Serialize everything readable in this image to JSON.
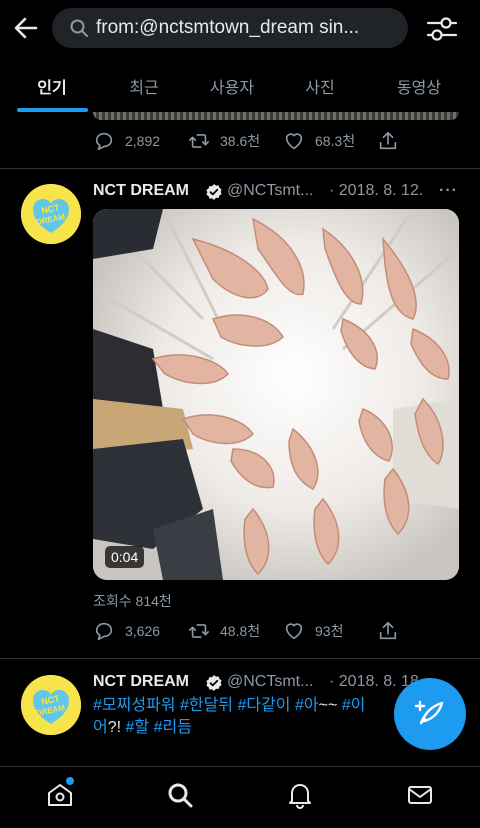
{
  "search": {
    "query": "from:@nctsmtown_dream sin..."
  },
  "tabs": [
    {
      "label": "인기",
      "active": true
    },
    {
      "label": "최근",
      "active": false
    },
    {
      "label": "사용자",
      "active": false
    },
    {
      "label": "사진",
      "active": false
    },
    {
      "label": "동영상",
      "active": false
    }
  ],
  "prev_tweet": {
    "replies": "2,892",
    "retweets": "38.6천",
    "likes": "68.3천"
  },
  "tweet1": {
    "name": "NCT DREAM",
    "handle": "@NCTsmt...",
    "date": "· 2018. 8. 12.",
    "more": "···",
    "video_duration": "0:04",
    "views": "조회수 814천",
    "replies": "3,626",
    "retweets": "48.8천",
    "likes": "93천"
  },
  "tweet2": {
    "name": "NCT DREAM",
    "handle": "@NCTsmt...",
    "date": "· 2018. 8. 18.",
    "text": {
      "h1": "#모찌성파워",
      "h2": "#한달뒤",
      "h3": "#다같이",
      "h4": "#아",
      "t1": "~~",
      "h5": "#이",
      "t2": "어",
      "t3": "?!",
      "h6": "#할",
      "h7": "#리듬"
    }
  },
  "colors": {
    "accent": "#1d9bf0",
    "background": "#000000",
    "muted": "#8b98a5",
    "avatar_bg": "#f7e44b"
  },
  "icons": [
    "back-arrow-icon",
    "search-icon",
    "filter-icon",
    "reply-icon",
    "retweet-icon",
    "like-icon",
    "share-icon",
    "verified-icon",
    "compose-icon",
    "home-icon",
    "explore-icon",
    "notifications-icon",
    "messages-icon"
  ]
}
